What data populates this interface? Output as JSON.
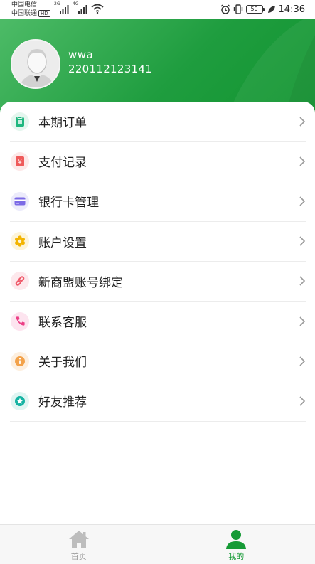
{
  "status_bar": {
    "carrier_1": "中国电信",
    "carrier_2": "中国联通",
    "hd_badge": "HD",
    "signal_1_type": "2G",
    "signal_2_type": "4G",
    "battery_level": "50",
    "time": "14:36"
  },
  "profile": {
    "name": "wwa",
    "id": "220112123141"
  },
  "menu": [
    {
      "label": "本期订单",
      "icon": "clipboard-icon",
      "icon_color": "#1fb77f",
      "bg": "#e4f6ee"
    },
    {
      "label": "支付记录",
      "icon": "payment-record-icon",
      "icon_color": "#ef5a5a",
      "bg": "#fde8e8"
    },
    {
      "label": "银行卡管理",
      "icon": "bank-card-icon",
      "icon_color": "#7b6ae6",
      "bg": "#ecebfb"
    },
    {
      "label": "账户设置",
      "icon": "gear-icon",
      "icon_color": "#f3b400",
      "bg": "#fdf4d9"
    },
    {
      "label": "新商盟账号绑定",
      "icon": "link-icon",
      "icon_color": "#ef5a6a",
      "bg": "#fde8ec"
    },
    {
      "label": "联系客服",
      "icon": "phone-icon",
      "icon_color": "#ec3f86",
      "bg": "#fde4ef"
    },
    {
      "label": "关于我们",
      "icon": "info-icon",
      "icon_color": "#f3a24a",
      "bg": "#fdefdf"
    },
    {
      "label": "好友推荐",
      "icon": "star-icon",
      "icon_color": "#16b3a3",
      "bg": "#dff5f2"
    }
  ],
  "bottom_nav": {
    "home_label": "首页",
    "mine_label": "我的"
  },
  "colors": {
    "brand_green": "#169a36",
    "inactive_nav": "#9a9a9a",
    "text": "#222222"
  }
}
